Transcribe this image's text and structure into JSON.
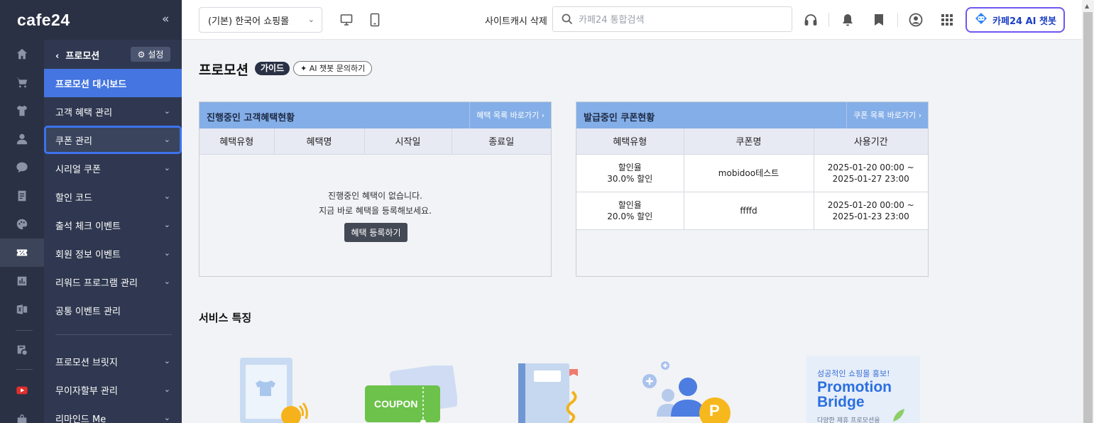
{
  "brand": {
    "logo": "cafe24",
    "collapse_icon": "«"
  },
  "submenu": {
    "back_label": "프로모션",
    "settings_label": "설정",
    "items": [
      {
        "label": "프로모션 대시보드",
        "state": "active"
      },
      {
        "label": "고객 혜택 관리",
        "chevron": "⌄"
      },
      {
        "label": "쿠폰 관리",
        "chevron": "⌄",
        "state": "focused"
      },
      {
        "label": "시리얼 쿠폰",
        "chevron": "⌄"
      },
      {
        "label": "할인 코드",
        "chevron": "⌄"
      },
      {
        "label": "출석 체크 이벤트",
        "chevron": "⌄"
      },
      {
        "label": "회원 정보 이벤트",
        "chevron": "⌄"
      },
      {
        "label": "리워드 프로그램 관리",
        "chevron": "⌄"
      },
      {
        "label": "공통 이벤트 관리"
      },
      {
        "label": "프로모션 브릿지",
        "chevron": "⌄"
      },
      {
        "label": "무이자할부 관리",
        "chevron": "⌄"
      },
      {
        "label": "리마인드 Me",
        "chevron": "⌄"
      }
    ]
  },
  "rail": {
    "icons": [
      "home-icon",
      "cart-icon",
      "tshirt-icon",
      "user-icon",
      "chat-icon",
      "board-icon",
      "palette-icon",
      "promotion-icon",
      "stats-icon",
      "excel-icon",
      "app-store-icon",
      "youtube-icon",
      "store-icon"
    ],
    "active": "promotion-icon"
  },
  "topbar": {
    "shop_select": "(기본) 한국어 쇼핑몰",
    "cache_label": "사이트캐시 삭제",
    "search_placeholder": "카페24 통합검색",
    "ai_chatbot_label": "카페24 AI 챗봇"
  },
  "page": {
    "title": "프로모션",
    "guide_badge": "가이드",
    "ai_ask_label": "AI 챗봇 문의하기"
  },
  "benefits_panel": {
    "title": "진행중인 고객혜택현황",
    "link": "혜택 목록 바로가기",
    "columns": [
      "혜택유형",
      "혜택명",
      "시작일",
      "종료일"
    ],
    "empty_line1": "진행중인 혜택이 없습니다.",
    "empty_line2": "지금 바로 혜택을 등록해보세요.",
    "register_button": "혜택 등록하기"
  },
  "coupons_panel": {
    "title": "발급중인 쿠폰현황",
    "link": "쿠폰 목록 바로가기",
    "columns": [
      "혜택유형",
      "쿠폰명",
      "사용기간"
    ],
    "rows": [
      {
        "type_line1": "할인율",
        "type_line2": "30.0% 할인",
        "name": "mobidoo테스트",
        "period_line1": "2025-01-20 00:00 ~",
        "period_line2": "2025-01-27 23:00"
      },
      {
        "type_line1": "할인율",
        "type_line2": "20.0% 할인",
        "name": "ffffd",
        "period_line1": "2025-01-20 00:00 ~",
        "period_line2": "2025-01-23 23:00"
      }
    ]
  },
  "services": {
    "title": "서비스 특징",
    "coupon_text": "COUPON",
    "points_text": "P",
    "bridge_tagline": "성공적인 쇼핑몰 홍보!",
    "bridge_title_1": "Promotion",
    "bridge_title_2": "Bridge",
    "bridge_sub": "다양한 제휴 프로모션을"
  },
  "colors": {
    "sidebar_bg": "#2a3145",
    "submenu_bg": "#2f3850",
    "active_item": "#4475e0",
    "panel_header": "#84aee7",
    "ai_button_border": "#6f56f0"
  }
}
